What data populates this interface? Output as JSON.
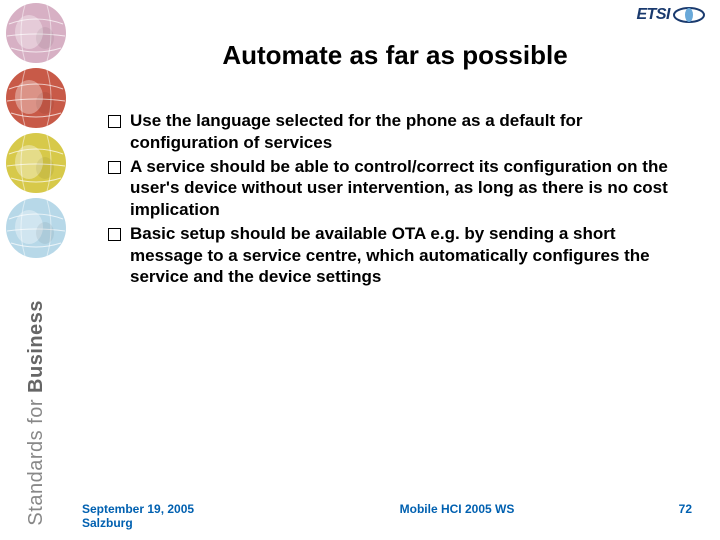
{
  "logo": {
    "text": "ETSI"
  },
  "sidebar": {
    "vertical_label_light": "Standards",
    "vertical_label_sep": " for ",
    "vertical_label_bold": "Business",
    "globe_colors": [
      "#d7b0c4",
      "#c85a48",
      "#d7c94a",
      "#b7d8e8"
    ]
  },
  "title": "Automate as far as possible",
  "bullets": [
    "Use the language selected for the phone as a default for configuration of services",
    "A service should be able to control/correct its configuration on the user's device without user intervention, as long as there is no cost implication",
    "Basic setup should be available OTA e.g. by sending a short message to a service centre, which automatically configures the service and the device settings"
  ],
  "footer": {
    "date": "September 19, 2005",
    "location": "Salzburg",
    "event": "Mobile HCI 2005 WS",
    "page": "72"
  }
}
